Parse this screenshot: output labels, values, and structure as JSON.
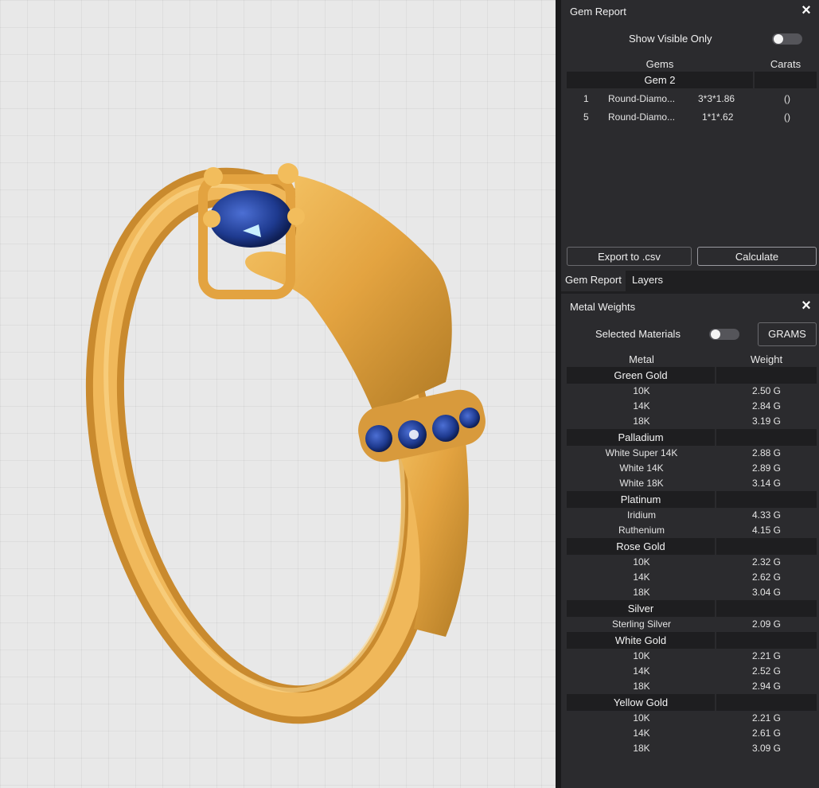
{
  "gem_report": {
    "title": "Gem Report",
    "show_visible_label": "Show Visible Only",
    "col_gems": "Gems",
    "col_carats": "Carats",
    "group": "Gem 2",
    "rows": [
      {
        "qty": "1",
        "name": "Round-Diamo...",
        "size": "3*3*1.86",
        "carats": "()"
      },
      {
        "qty": "5",
        "name": "Round-Diamo...",
        "size": "1*1*.62",
        "carats": "()"
      }
    ],
    "export_label": "Export to .csv",
    "calculate_label": "Calculate"
  },
  "tabs": [
    "Gem Report",
    "Layers"
  ],
  "metal_weights": {
    "title": "Metal Weights",
    "selected_label": "Selected Materials",
    "units_label": "GRAMS",
    "col_metal": "Metal",
    "col_weight": "Weight",
    "groups": [
      {
        "name": "Green Gold",
        "rows": [
          [
            "10K",
            "2.50 G"
          ],
          [
            "14K",
            "2.84 G"
          ],
          [
            "18K",
            "3.19 G"
          ]
        ]
      },
      {
        "name": "Palladium",
        "rows": [
          [
            "White Super 14K",
            "2.88 G"
          ],
          [
            "White 14K",
            "2.89 G"
          ],
          [
            "White 18K",
            "3.14 G"
          ]
        ]
      },
      {
        "name": "Platinum",
        "rows": [
          [
            "Iridium",
            "4.33 G"
          ],
          [
            "Ruthenium",
            "4.15 G"
          ]
        ]
      },
      {
        "name": "Rose Gold",
        "rows": [
          [
            "10K",
            "2.32 G"
          ],
          [
            "14K",
            "2.62 G"
          ],
          [
            "18K",
            "3.04 G"
          ]
        ]
      },
      {
        "name": "Silver",
        "rows": [
          [
            "Sterling Silver",
            "2.09 G"
          ]
        ]
      },
      {
        "name": "White Gold",
        "rows": [
          [
            "10K",
            "2.21 G"
          ],
          [
            "14K",
            "2.52 G"
          ],
          [
            "18K",
            "2.94 G"
          ]
        ]
      },
      {
        "name": "Yellow Gold",
        "rows": [
          [
            "10K",
            "2.21 G"
          ],
          [
            "14K",
            "2.61 G"
          ],
          [
            "18K",
            "3.09 G"
          ]
        ]
      }
    ]
  },
  "colors": {
    "gold": "#e8a845",
    "sapphire": "#1e3a8f",
    "panel": "#2b2b2e"
  },
  "icons": {
    "close": "close-icon"
  }
}
